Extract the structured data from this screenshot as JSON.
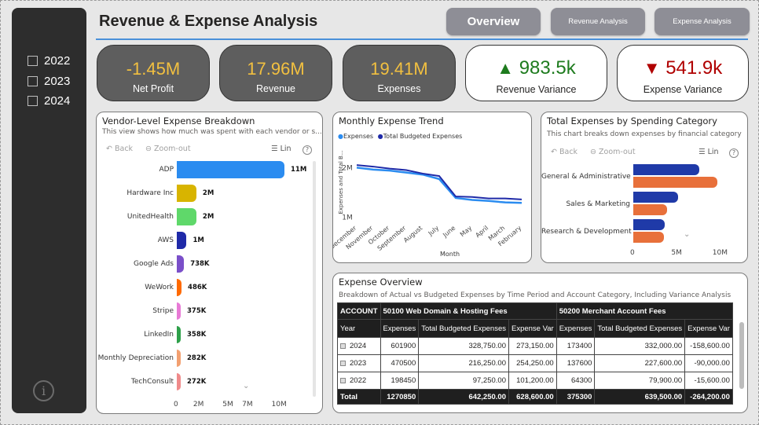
{
  "header": {
    "title": "Revenue & Expense Analysis"
  },
  "nav": {
    "overview": "Overview",
    "revenue": "Revenue Analysis",
    "expense": "Expense Analysis"
  },
  "slicer": {
    "years": [
      "2022",
      "2023",
      "2024"
    ]
  },
  "kpis": {
    "net_profit": {
      "value": "-1.45M",
      "label": "Net Profit"
    },
    "revenue": {
      "value": "17.96M",
      "label": "Revenue"
    },
    "expenses": {
      "value": "19.41M",
      "label": "Expenses"
    },
    "revenue_variance": {
      "value": "983.5k",
      "label": "Revenue Variance",
      "color": "#1e7b1e"
    },
    "expense_variance": {
      "value": "541.9k",
      "label": "Expense Variance",
      "color": "#b00000"
    }
  },
  "toolbar": {
    "back": "Back",
    "zoom_out": "Zoom-out",
    "lin": "Lin",
    "help": "?"
  },
  "vendor_chart": {
    "title": "Vendor-Level Expense Breakdown",
    "subtitle": "This view shows how much was spent with each vendor or s...",
    "x_ticks": [
      "0",
      "2M",
      "5M",
      "7M",
      "10M"
    ]
  },
  "trend_chart": {
    "title": "Monthly Expense Trend",
    "legend": [
      "Expenses",
      "Total Budgeted Expenses"
    ],
    "ylabel": "Expenses and Total B...",
    "xlabel": "Month",
    "y_ticks": [
      "2M",
      "1M"
    ]
  },
  "category_chart": {
    "title": "Total Expenses by Spending Category",
    "subtitle": "This chart breaks down expenses by financial category",
    "x_ticks": [
      "0",
      "5M",
      "10M"
    ]
  },
  "table": {
    "title": "Expense Overview",
    "subtitle": "Breakdown of Actual vs Budgeted  Expenses by Time Period and Account Category, Including Variance Analysis",
    "account_label": "ACCOUNT",
    "groups": [
      "50100 Web Domain & Hosting Fees",
      "50200 Merchant Account Fees"
    ],
    "columns": [
      "Year",
      "Expenses",
      "Total Budgeted Expenses",
      "Expense Var",
      "Expenses",
      "Total Budgeted Expenses",
      "Expense Var"
    ],
    "rows": [
      [
        "2024",
        "601900",
        "328,750.00",
        "273,150.00",
        "173400",
        "332,000.00",
        "-158,600.00"
      ],
      [
        "2023",
        "470500",
        "216,250.00",
        "254,250.00",
        "137600",
        "227,600.00",
        "-90,000.00"
      ],
      [
        "2022",
        "198450",
        "97,250.00",
        "101,200.00",
        "64300",
        "79,900.00",
        "-15,600.00"
      ]
    ],
    "total": [
      "Total",
      "1270850",
      "642,250.00",
      "628,600.00",
      "375300",
      "639,500.00",
      "-264,200.00"
    ]
  },
  "chart_data": [
    {
      "type": "bar",
      "orientation": "horizontal",
      "title": "Vendor-Level Expense Breakdown",
      "categories": [
        "ADP",
        "Hardware Inc",
        "UnitedHealth",
        "AWS",
        "Google Ads",
        "WeWork",
        "Stripe",
        "LinkedIn",
        "Monthly Depreciation",
        "TechConsult"
      ],
      "values": [
        11000000,
        2000000,
        2000000,
        1000000,
        738000,
        486000,
        375000,
        358000,
        282000,
        272000
      ],
      "labels": [
        "11M",
        "2M",
        "2M",
        "1M",
        "738K",
        "486K",
        "375K",
        "358K",
        "282K",
        "272K"
      ],
      "colors": [
        "#2b8cf0",
        "#d8b400",
        "#5fd86a",
        "#1f2aa8",
        "#7a4fc9",
        "#ff6a00",
        "#e87ad6",
        "#2ea04a",
        "#f2a070",
        "#f08a8a"
      ],
      "xlim": [
        0,
        11000000
      ]
    },
    {
      "type": "line",
      "title": "Monthly Expense Trend",
      "categories": [
        "December",
        "November",
        "October",
        "September",
        "August",
        "July",
        "June",
        "May",
        "April",
        "March",
        "February"
      ],
      "series": [
        {
          "name": "Expenses",
          "color": "#2b8cf0",
          "values": [
            2000000,
            1960000,
            1940000,
            1900000,
            1860000,
            1770000,
            1390000,
            1350000,
            1330000,
            1300000,
            1290000
          ]
        },
        {
          "name": "Total Budgeted Expenses",
          "color": "#1f2aa8",
          "values": [
            2050000,
            2020000,
            1980000,
            1950000,
            1880000,
            1830000,
            1420000,
            1410000,
            1380000,
            1380000,
            1360000
          ]
        }
      ],
      "ylim": [
        900000,
        2400000
      ],
      "xlabel": "Month"
    },
    {
      "type": "bar",
      "orientation": "horizontal",
      "title": "Total Expenses by Spending Category",
      "categories": [
        "General & Administrative",
        "Sales & Marketing",
        "Research & Development"
      ],
      "series": [
        {
          "name": "Total Budgeted Expenses",
          "color": "#1f3aa8",
          "values": [
            8000000,
            5400000,
            3800000
          ]
        },
        {
          "name": "Expenses",
          "color": "#e8703a",
          "values": [
            10200000,
            4100000,
            3700000
          ]
        }
      ],
      "xlim": [
        0,
        10500000
      ]
    }
  ]
}
